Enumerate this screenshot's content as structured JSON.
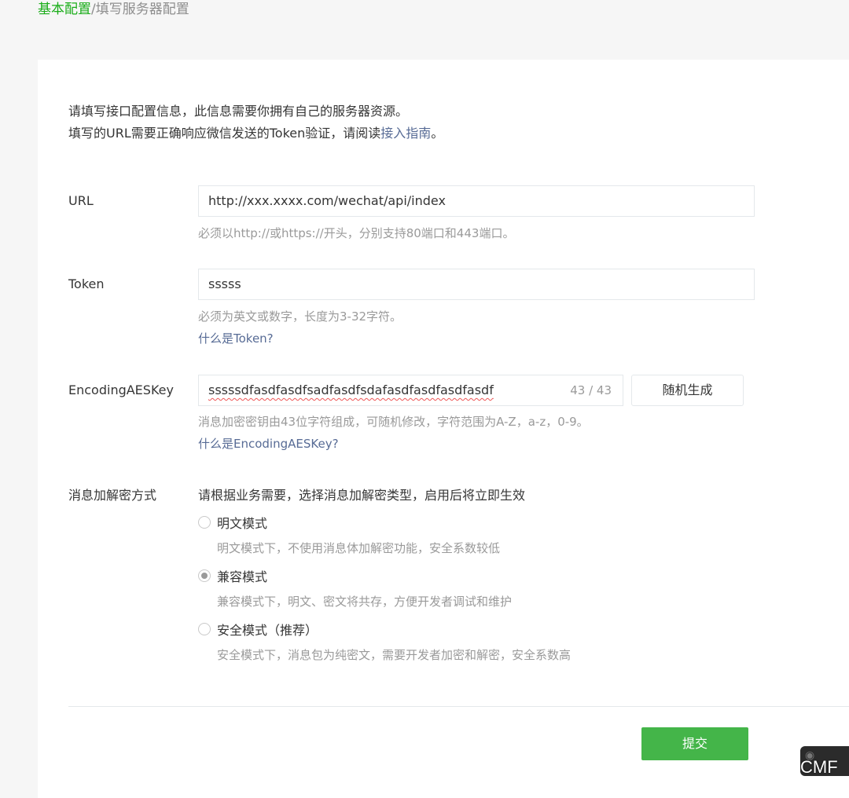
{
  "breadcrumb": {
    "current_link": "基本配置",
    "separator": "/",
    "page": "填写服务器配置"
  },
  "intro": {
    "line1": "请填写接口配置信息，此信息需要你拥有自己的服务器资源。",
    "line2_before": "填写的URL需要正确响应微信发送的Token验证，请阅读",
    "line2_link": "接入指南",
    "line2_after": "。"
  },
  "url": {
    "label": "URL",
    "value": "http://xxx.xxxx.com/wechat/api/index",
    "hint": "必须以http://或https://开头，分别支持80端口和443端口。"
  },
  "token": {
    "label": "Token",
    "value": "sssss",
    "hint": "必须为英文或数字，长度为3-32字符。",
    "help_link": "什么是Token?"
  },
  "aes": {
    "label": "EncodingAESKey",
    "value": "sssssdfasdfasdfsadfasdfsdafasdfasdfasdfasdf",
    "counter": "43 / 43",
    "random_button": "随机生成",
    "hint": "消息加密密钥由43位字符组成，可随机修改，字符范围为A-Z，a-z，0-9。",
    "help_link": "什么是EncodingAESKey?"
  },
  "encryption": {
    "label": "消息加解密方式",
    "description": "请根据业务需要，选择消息加解密类型，启用后将立即生效",
    "options": [
      {
        "label": "明文模式",
        "desc": "明文模式下，不使用消息体加解密功能，安全系数较低",
        "checked": false
      },
      {
        "label": "兼容模式",
        "desc": "兼容模式下，明文、密文将共存，方便开发者调试和维护",
        "checked": true
      },
      {
        "label": "安全模式（推荐）",
        "desc": "安全模式下，消息包为纯密文，需要开发者加密和解密，安全系数高",
        "checked": false
      }
    ]
  },
  "submit_button": "提交",
  "watermark": {
    "text": "CMF"
  },
  "colors": {
    "primary_green": "#44b549",
    "link_green": "#1aad19",
    "link_blue": "#576b95",
    "hint_gray": "#9a9a9a"
  }
}
